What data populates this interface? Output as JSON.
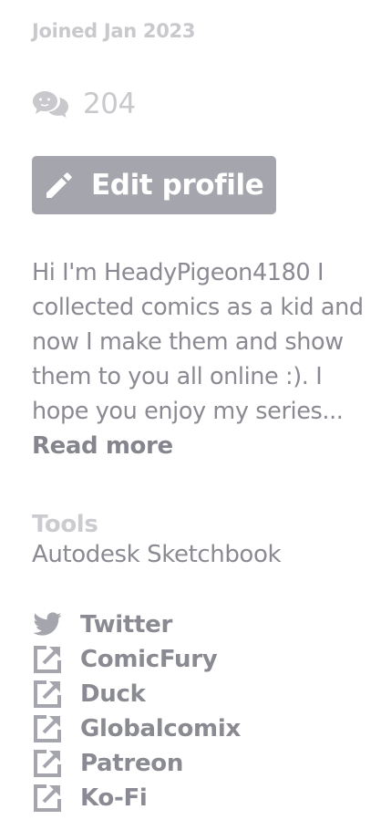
{
  "profile": {
    "joined": "Joined Jan 2023",
    "comment_count": "204",
    "edit_label": "Edit profile",
    "bio_lines": [
      "Hi I'm HeadyPigeon4180 I",
      "collected comics as a kid and",
      "now I make them and show",
      "them to you all online :). I",
      "hope you enjoy my series..."
    ],
    "read_more": "Read more"
  },
  "tools": {
    "heading": "Tools",
    "value": "Autodesk Sketchbook"
  },
  "links": [
    {
      "label": "Twitter",
      "icon": "twitter-icon"
    },
    {
      "label": "ComicFury",
      "icon": "external-link-icon"
    },
    {
      "label": "Duck",
      "icon": "external-link-icon"
    },
    {
      "label": "Globalcomix",
      "icon": "external-link-icon"
    },
    {
      "label": "Patreon",
      "icon": "external-link-icon"
    },
    {
      "label": "Ko-Fi",
      "icon": "external-link-icon"
    }
  ],
  "colors": {
    "button_bg": "#a5a5ad",
    "text": "#8a8a92",
    "muted": "#c9c9cd"
  }
}
